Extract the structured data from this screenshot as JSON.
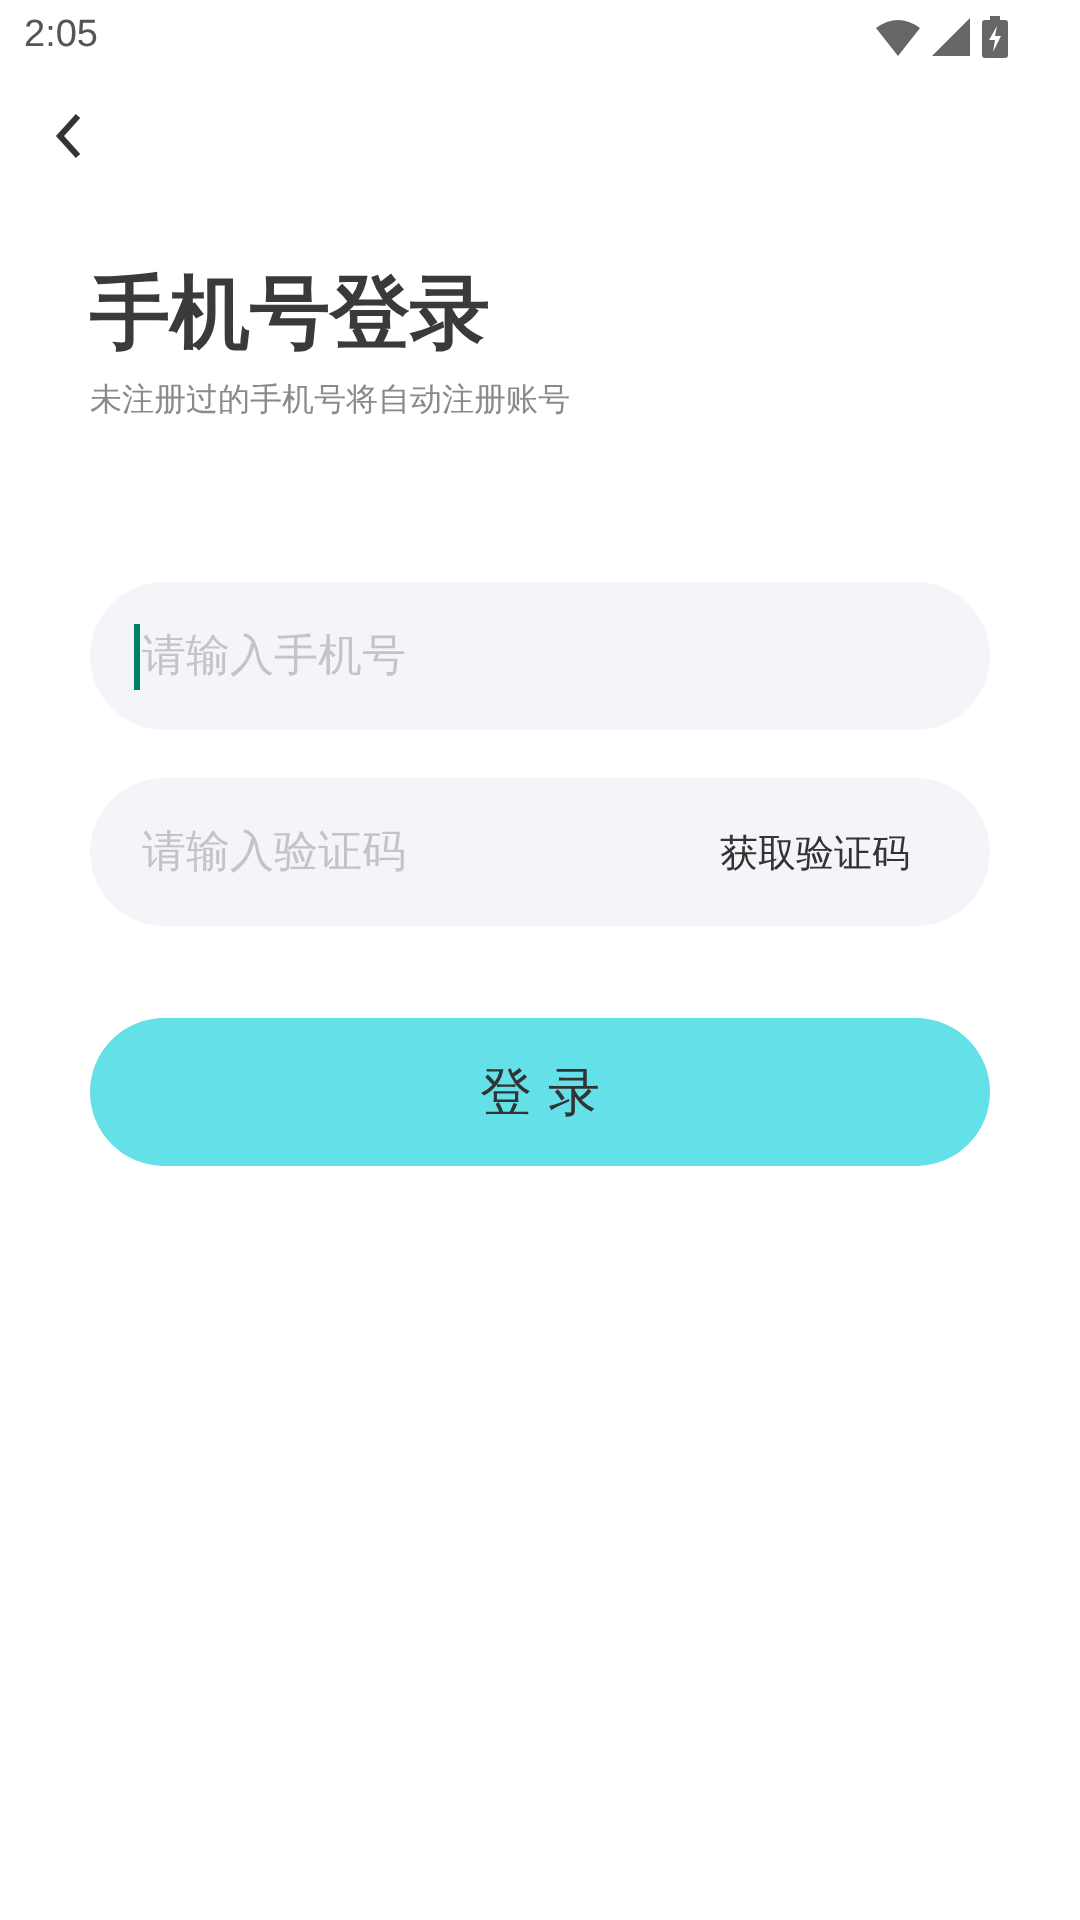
{
  "status_bar": {
    "time": "2:05"
  },
  "title": "手机号登录",
  "subtitle": "未注册过的手机号将自动注册账号",
  "fields": [
    {
      "kind": "phone",
      "placeholder": "请输入手机号",
      "focused": true
    },
    {
      "kind": "code",
      "placeholder": "请输入验证码",
      "focused": false,
      "action": "获取验证码"
    }
  ],
  "login_button": "登 录"
}
